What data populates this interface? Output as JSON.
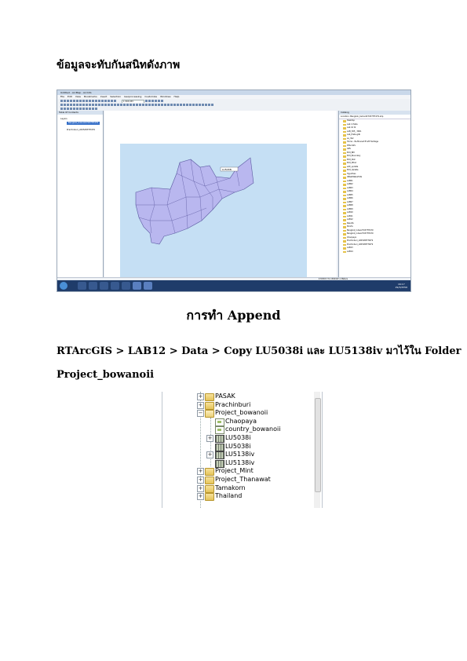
{
  "heading1": "ข้อมูลจะทับกันสนิทดังภาพ",
  "heading2": "การทำ Append",
  "instruction": "RTArcGIS > LAB12 > Data > Copy  LU5038i และ LU5138iv มาไว้ใน Folder",
  "instruction_cont": "Project_bowanoii",
  "screenshot1": {
    "window_title": "Untitled - ArcMap - ArcInfo",
    "menu": [
      "File",
      "Edit",
      "View",
      "Bookmarks",
      "Insert",
      "Selection",
      "Geoprocessing",
      "Customize",
      "Windows",
      "Help"
    ],
    "scale": "1:303,033",
    "toc_title": "Table Of Contents",
    "toc_items": [
      "Layers",
      "Bangkok_bvboot27037TH479",
      "Prachinburi_x005d83TH479"
    ],
    "map_label": "LU5038i",
    "catalog_title": "Catalog",
    "catalog_location": "Location: Bangkok_bvboot27037TH479.shp",
    "catalog_items": [
      "Desktop",
      "Lab 1 Prete",
      "Lab 10 t2",
      "LAB_305_ 30K1",
      "Lab_Prete.gdb",
      "ax_3k2",
      "Home - Pe-Mosnet Pt aft Heritage",
      "RTArcGIS",
      "GPS",
      "Edit_BM",
      "Edit_Boundary",
      "Edit_Dist",
      "Edit_Mtnd",
      "edit_update",
      "Edit_Update",
      "Hypothes",
      "IMAGEANALYSIS",
      "LAB01",
      "LAB02",
      "LAB03",
      "LAB04",
      "LAB05",
      "LAB06",
      "LAB07",
      "LAB08",
      "LAB09",
      "LAB10",
      "LAB11",
      "LAB12",
      "Results",
      "Shorts",
      "Bangkok_Indeo27037TH479",
      "Bangkok_Indeo27037TH479",
      "Chaopaya",
      "Prachinburi_x005d83TH479",
      "Prachinburi_x005d83TH479",
      "LAB13",
      "LAB14"
    ],
    "status_coords": "470303.771  1560197.1 Meters",
    "clock_time": "16:17",
    "clock_date": "29/3/2556"
  },
  "screenshot2": {
    "tree": [
      {
        "label": "PASAK",
        "type": "folder",
        "expander": "+"
      },
      {
        "label": "Prachinburi",
        "type": "folder",
        "expander": "+"
      },
      {
        "label": "Project_bowanoii",
        "type": "folder-open",
        "expander": "−"
      },
      {
        "label": "Chaopaya",
        "type": "fc",
        "expander": ""
      },
      {
        "label": "country_bowanoii",
        "type": "fc",
        "expander": ""
      },
      {
        "label": "LU5038i",
        "type": "raster",
        "expander": "+"
      },
      {
        "label": "LU5038i",
        "type": "raster",
        "expander": ""
      },
      {
        "label": "LU5138iv",
        "type": "raster",
        "expander": "+"
      },
      {
        "label": "LU5138iv",
        "type": "raster",
        "expander": ""
      },
      {
        "label": "Project_Mint",
        "type": "folder",
        "expander": "+"
      },
      {
        "label": "Project_Thanawat",
        "type": "folder",
        "expander": "+"
      },
      {
        "label": "Tamakorn",
        "type": "folder",
        "expander": "+"
      },
      {
        "label": "Thailand",
        "type": "folder",
        "expander": "+"
      }
    ]
  },
  "colors": {
    "map_polygon": "#b9b7ef",
    "map_outline": "#5a58a0",
    "map_bg": "#c5dff4",
    "folder": "#e4c35a"
  }
}
